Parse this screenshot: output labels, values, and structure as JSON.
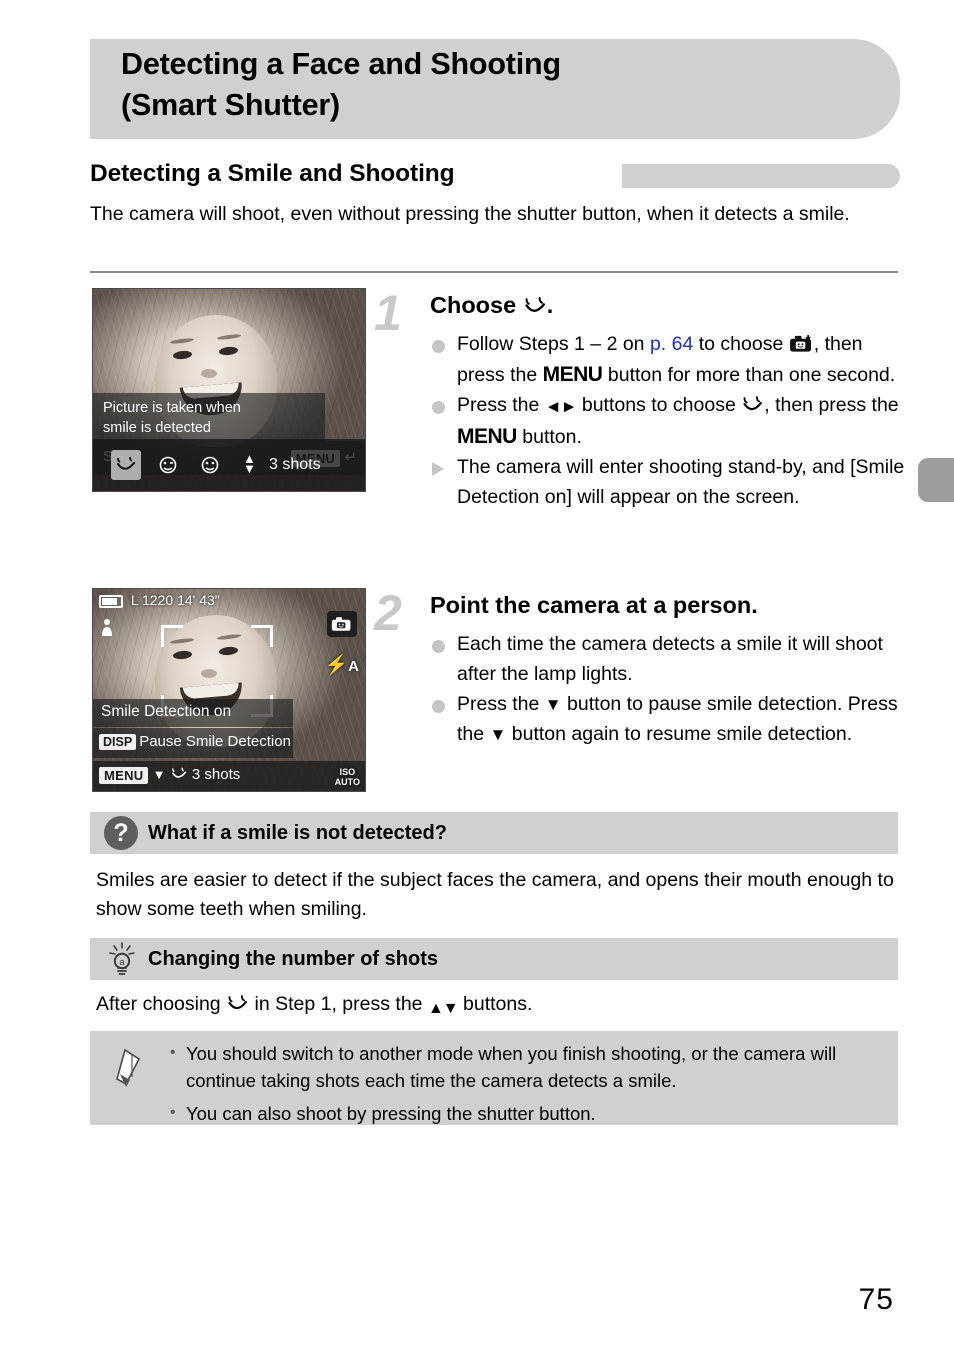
{
  "page": {
    "number": "75",
    "title_line1": "Detecting a Face and Shooting",
    "title_line2": "(Smart Shutter)"
  },
  "section": {
    "heading": "Detecting a Smile and Shooting",
    "intro": "The camera will shoot, even without pressing the shutter button, when it detects a smile."
  },
  "steps": [
    {
      "number": "1",
      "heading_prefix": "Choose",
      "heading_suffix": ".",
      "bullets": [
        {
          "marker": "dot",
          "parts": [
            {
              "t": "text",
              "v": "Follow Steps 1 – 2 on "
            },
            {
              "t": "link",
              "v": "p. 64"
            },
            {
              "t": "text",
              "v": " to choose "
            },
            {
              "t": "icon",
              "v": "camera-smile-icon"
            },
            {
              "t": "text",
              "v": ", then press the "
            },
            {
              "t": "menu",
              "v": "MENU"
            },
            {
              "t": "text",
              "v": " button for more than one second."
            }
          ]
        },
        {
          "marker": "dot",
          "parts": [
            {
              "t": "text",
              "v": "Press the "
            },
            {
              "t": "icon",
              "v": "left-right-arrows-icon"
            },
            {
              "t": "text",
              "v": " buttons to choose "
            },
            {
              "t": "icon",
              "v": "smile-face-icon"
            },
            {
              "t": "text",
              "v": ", then press the "
            },
            {
              "t": "menu",
              "v": "MENU"
            },
            {
              "t": "text",
              "v": " button."
            }
          ]
        },
        {
          "marker": "triangle",
          "parts": [
            {
              "t": "text",
              "v": "The camera will enter shooting stand-by, and [Smile Detection on] will appear on the screen."
            }
          ]
        }
      ]
    },
    {
      "number": "2",
      "heading_prefix": "Point the camera at a person.",
      "heading_suffix": "",
      "bullets": [
        {
          "marker": "dot",
          "parts": [
            {
              "t": "text",
              "v": "Each time the camera detects a smile it will shoot after the lamp lights."
            }
          ]
        },
        {
          "marker": "dot",
          "parts": [
            {
              "t": "text",
              "v": "Press the "
            },
            {
              "t": "icon",
              "v": "down-arrow-icon"
            },
            {
              "t": "text",
              "v": " button to pause smile detection. Press the "
            },
            {
              "t": "icon",
              "v": "down-arrow-icon"
            },
            {
              "t": "text",
              "v": " button again to resume smile detection."
            }
          ]
        }
      ]
    }
  ],
  "screenshots": {
    "shot1": {
      "message_line1": "Picture is taken when",
      "message_line2": "smile is detected",
      "mode_label": "Smile",
      "menu_chip": "MENU",
      "menu_return_icon": "return-arrow-icon",
      "shots_label": "3 shots",
      "updown_icon": "up-down-arrows-icon",
      "modes": [
        "smile-face-icon",
        "wink-self-timer-icon",
        "face-self-timer-icon"
      ],
      "selected_mode_index": 0
    },
    "shot2": {
      "top_info": "L 1220  14' 43\"",
      "battery_icon": "battery-full-icon",
      "quality_icon": "quality-fine-large-icon",
      "movie_icon": "movie-quality-icon",
      "status_line": "Smile Detection on",
      "disp_chip": "DISP",
      "disp_text": "Pause Smile Detection",
      "menu_chip": "MENU",
      "bottom_shots": "3 shots",
      "bottom_mode_icon": "smile-face-icon",
      "flash_label": "A",
      "flash_icon": "flash-auto-icon",
      "mode_badge_icon": "camera-smile-icon",
      "iso_label_line1": "ISO",
      "iso_label_line2": "AUTO"
    }
  },
  "tips": [
    {
      "icon": "question-mark-icon",
      "title": "What if a smile is not detected?",
      "body": "Smiles are easier to detect if the subject faces the camera, and opens their mouth enough to show some teeth when smiling."
    },
    {
      "icon": "lightbulb-icon",
      "title": "Changing the number of shots",
      "body_parts": [
        {
          "t": "text",
          "v": "After choosing "
        },
        {
          "t": "icon",
          "v": "smile-face-icon"
        },
        {
          "t": "text",
          "v": " in Step 1, press the "
        },
        {
          "t": "icon",
          "v": "up-down-arrows-icon"
        },
        {
          "t": "text",
          "v": " buttons."
        }
      ]
    }
  ],
  "note": {
    "icon": "pencil-icon",
    "items": [
      "You should switch to another mode when you finish shooting, or the camera will continue taking shots each time the camera detects a smile.",
      "You can also shoot by pressing the shutter button."
    ]
  },
  "colors": {
    "banner_gray": "#d0d0d0",
    "tab_gray": "#9d9d9d",
    "link_blue": "#1a2fd0",
    "bullet_gray": "#c6c6c6",
    "step_number_gray": "#c8c8c8"
  }
}
